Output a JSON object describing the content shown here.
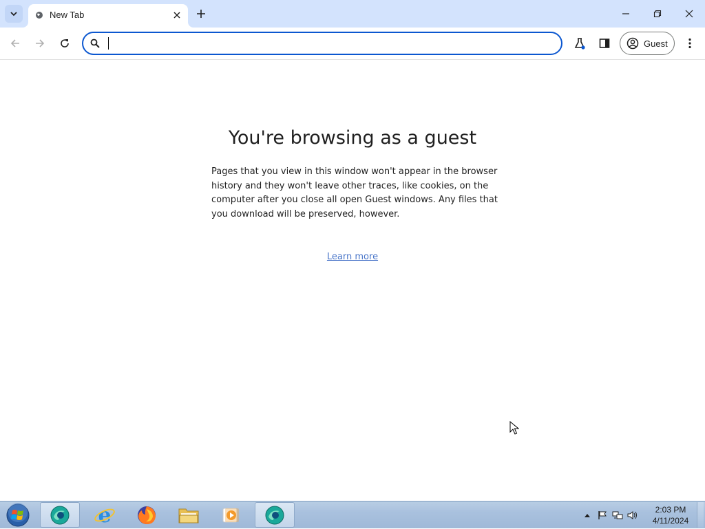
{
  "browser": {
    "tab": {
      "title": "New Tab"
    },
    "omnibox": {
      "value": "",
      "placeholder": ""
    },
    "profile": {
      "label": "Guest"
    }
  },
  "page": {
    "headline": "You're browsing as a guest",
    "description": "Pages that you view in this window won't appear in the browser history and they won't leave other traces, like cookies, on the computer after you close all open Guest windows. Any files that you download will be preserved, however.",
    "learn_more": "Learn more"
  },
  "taskbar": {
    "apps": [
      "chrome",
      "internet-explorer",
      "firefox",
      "file-explorer",
      "media-player",
      "chrome"
    ],
    "clock": {
      "time": "2:03 PM",
      "date": "4/11/2024"
    }
  },
  "colors": {
    "tabstrip": "#d3e3fd",
    "omnibox_border": "#0b57d0",
    "link": "#4a76c9",
    "taskbar": "#a9c1de"
  }
}
